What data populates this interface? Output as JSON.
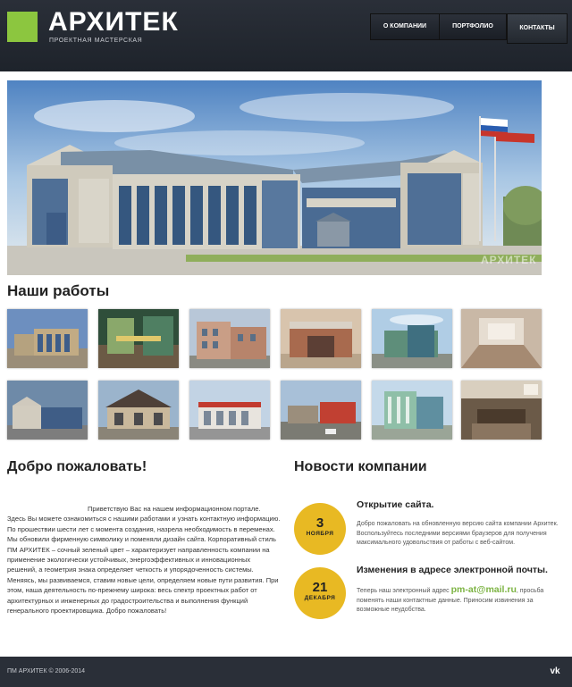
{
  "header": {
    "logo_title": "АРХИТЕК",
    "logo_subtitle": "ПРОЕКТНАЯ МАСТЕРСКАЯ",
    "nav": [
      "О КОМПАНИИ",
      "ПОРТФОЛИО",
      "КОНТАКТЫ"
    ]
  },
  "hero": {
    "watermark": "АРХИТЕК"
  },
  "works": {
    "title": "Наши работы",
    "thumb_watermark": "АРХИТЕК"
  },
  "welcome": {
    "title": "Добро пожаловать!",
    "text": "Приветствую Вас на нашем информационном портале. Здесь Вы можете ознакомиться с нашими работами и узнать контактную информацию. По прошествии шести лет с момента создания, назрела необходимость в переменах. Мы обновили фирменную символику и поменяли дизайн сайта. Корпоративный стиль ПМ АРХИТЕК – сочный зеленый цвет – характеризует направленность компании на применение экологически устойчивых, энергоэффективных и инновационных решений, а геометрия знака определяет четкость и упорядоченность системы. Меняясь, мы развиваемся, ставим новые цели, определяем новые пути развития. При этом, наша деятельность по-прежнему широка: весь спектр проектных работ от архитектурных и инженерных до градостроительства и выполнения функций генерального проектировщика. Добро пожаловать!"
  },
  "news": {
    "title": "Новости компании",
    "items": [
      {
        "day": "3",
        "month": "НОЯБРЯ",
        "heading": "Открытие сайта.",
        "text": "Добро пожаловать на обновленную версию сайта компании Архитек. Воспользуйтесь последними версиями браузеров для получения максимального удовольствия от работы с веб-сайтом."
      },
      {
        "day": "21",
        "month": "ДЕКАБРЯ",
        "heading": "Изменения в адресе электронной почты.",
        "text_before": "Теперь наш электронный адрес",
        "email": "pm-at@mail.ru",
        "text_after": ", просьба поменять наши контактные данные. Приносим извинения за возможные неудобства."
      }
    ]
  },
  "footer": {
    "copyright": "ПМ АРХИТЕК © 2006-2014",
    "social_icon": "vk-icon"
  },
  "colors": {
    "accent_green": "#8cc63f",
    "accent_yellow": "#e8b923",
    "dark_header": "#2a2f38"
  }
}
